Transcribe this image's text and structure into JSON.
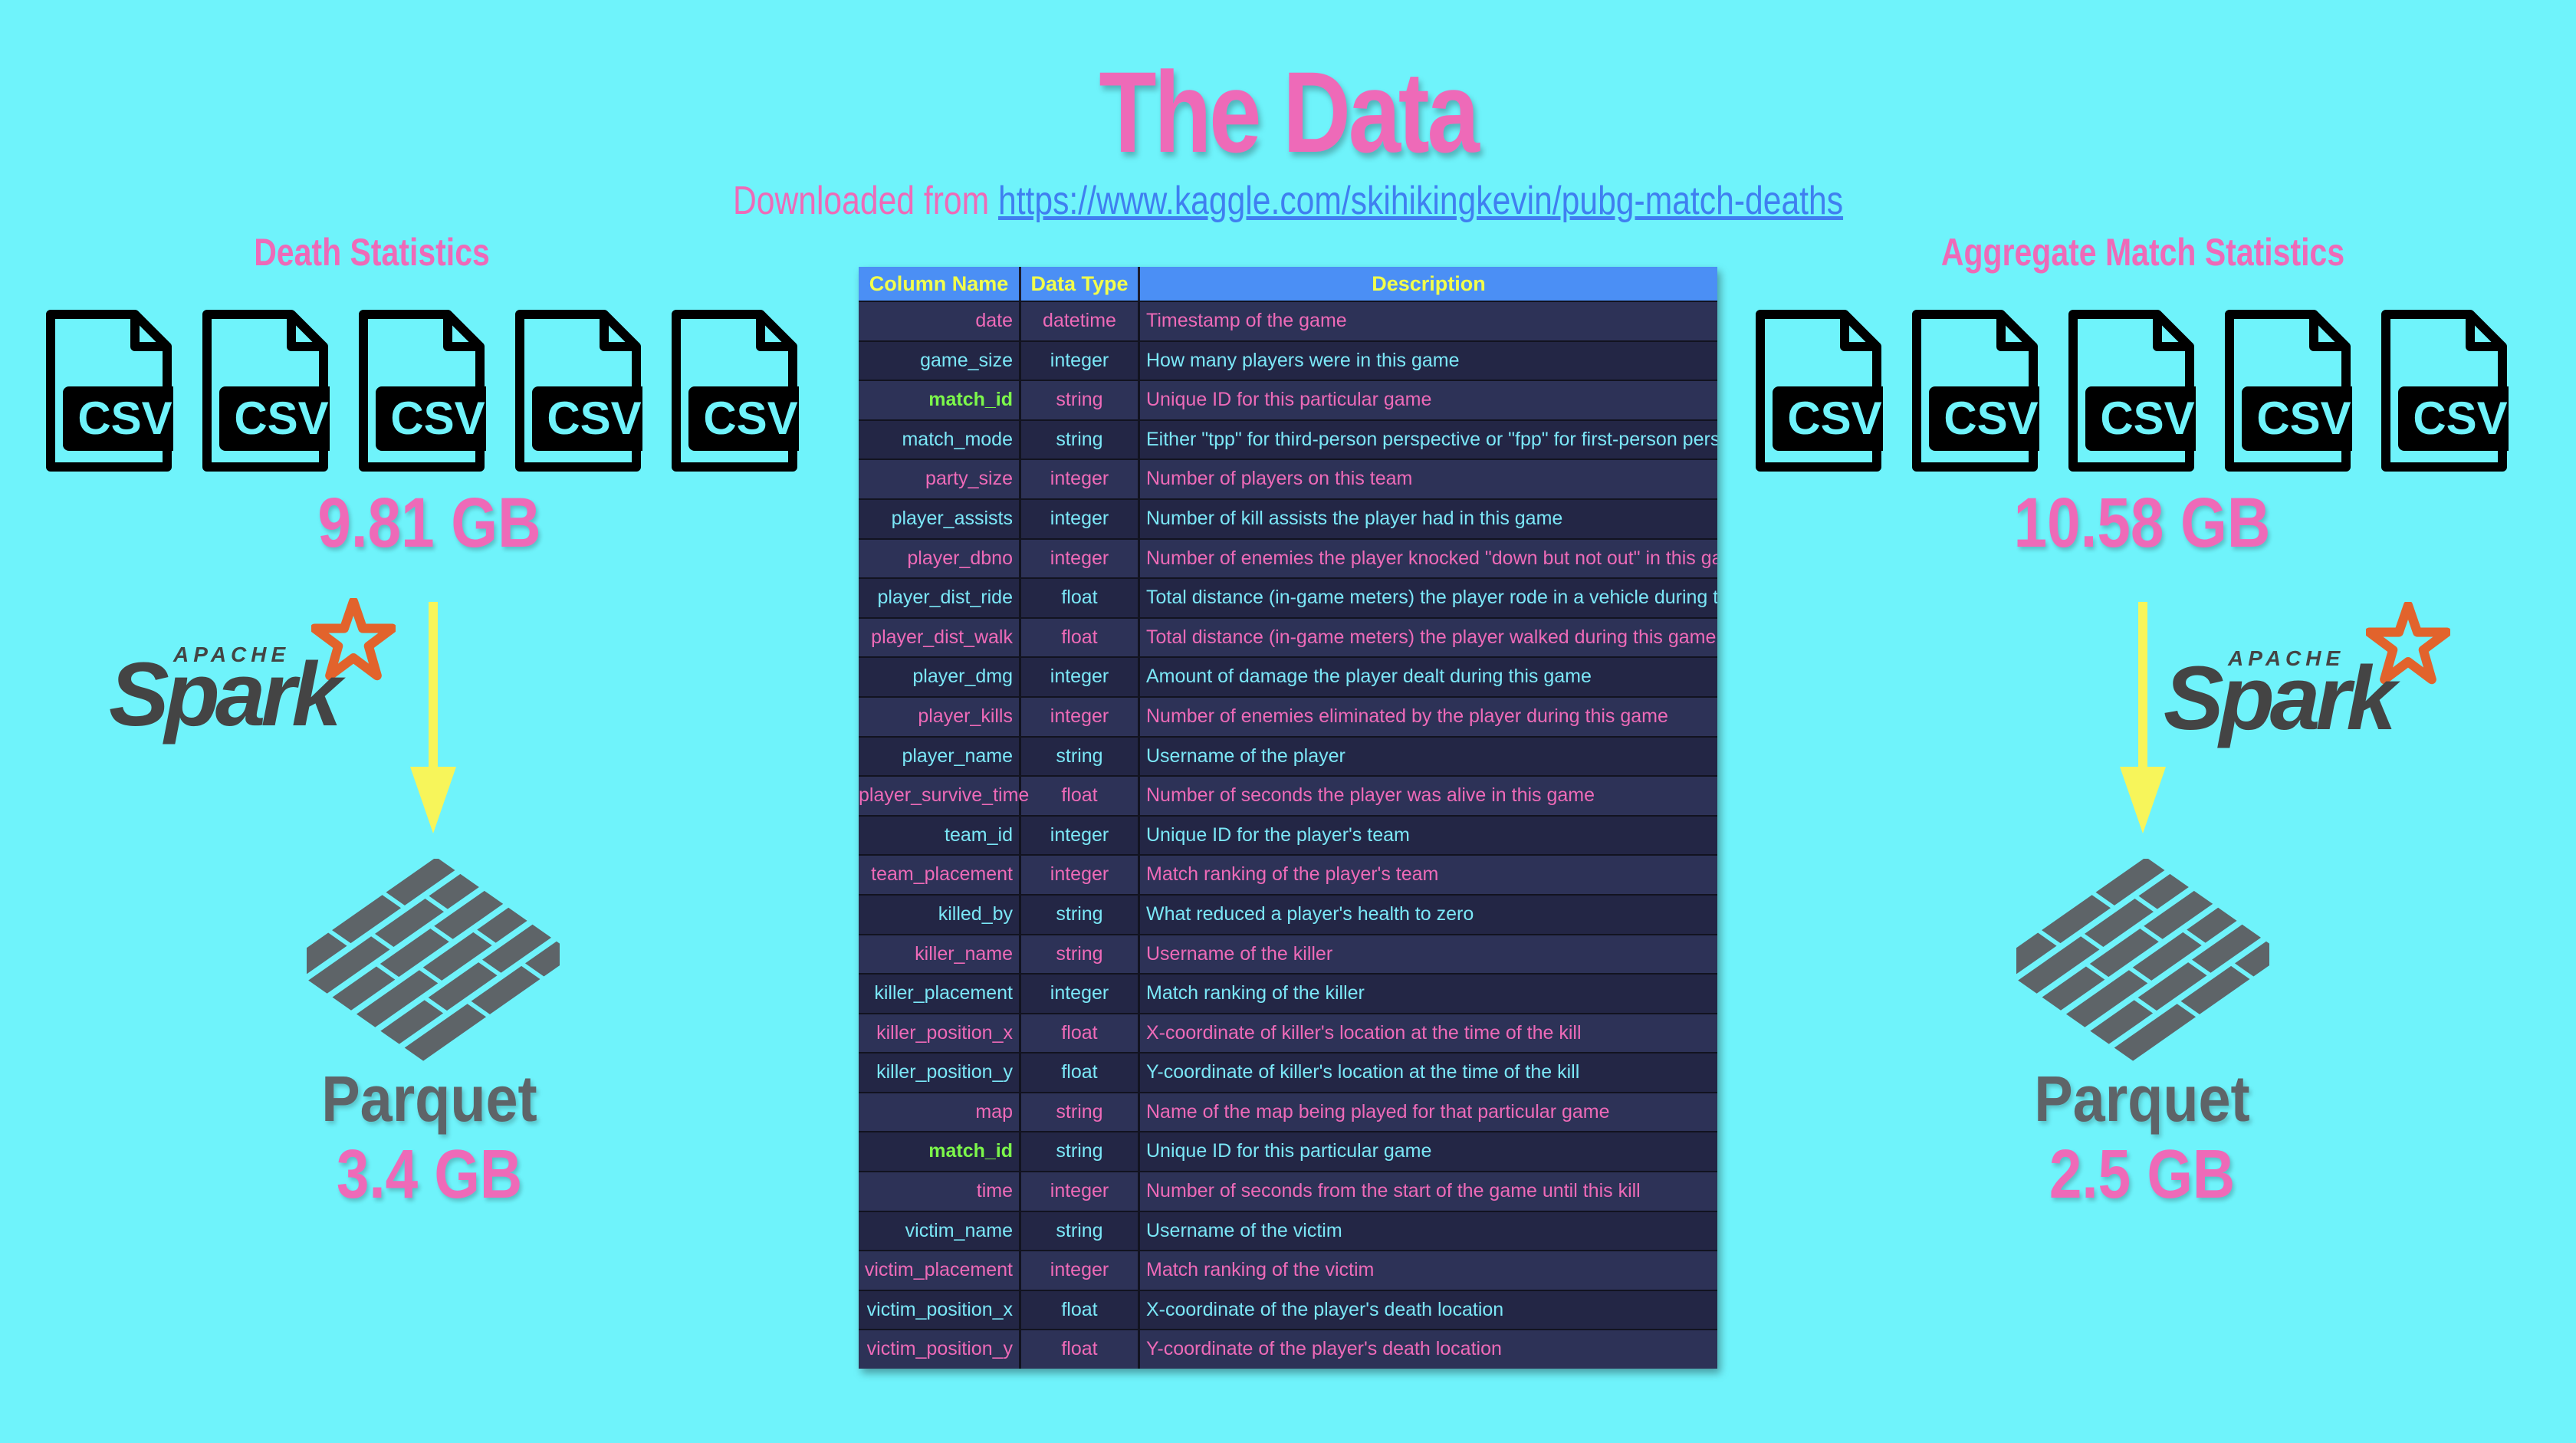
{
  "title": "The Data",
  "subtitle": {
    "prefix": "Downloaded from ",
    "link": "https://www.kaggle.com/skihikingkevin/pubg-match-deaths"
  },
  "left": {
    "heading": "Death Statistics",
    "file_label": "CSV",
    "csv_size": "9.81 GB",
    "spark_apache": "APACHE",
    "spark_name": "Spark",
    "parquet_label": "Parquet",
    "parquet_size": "3.4 GB"
  },
  "right": {
    "heading": "Aggregate Match Statistics",
    "file_label": "CSV",
    "csv_size": "10.58 GB",
    "spark_apache": "APACHE",
    "spark_name": "Spark",
    "parquet_label": "Parquet",
    "parquet_size": "2.5 GB"
  },
  "colors": {
    "background": "#6ff3fb",
    "pink": "#ee6ab8",
    "yellow_arrow": "#f7f55a",
    "table_header": "#4b8ff5",
    "highlight_green": "#7cf74a"
  },
  "table": {
    "headers": [
      "Column Name",
      "Data Type",
      "Description"
    ],
    "rows": [
      {
        "name": "date",
        "type": "datetime",
        "desc": "Timestamp of the game",
        "color": "pink"
      },
      {
        "name": "game_size",
        "type": "integer",
        "desc": "How many players were in this game",
        "color": "blue"
      },
      {
        "name": "match_id",
        "type": "string",
        "desc": "Unique ID for this particular game",
        "color": "pink",
        "highlight": true
      },
      {
        "name": "match_mode",
        "type": "string",
        "desc": "Either \"tpp\" for third-person perspective or \"fpp\" for first-person perspective",
        "color": "blue"
      },
      {
        "name": "party_size",
        "type": "integer",
        "desc": "Number of players on this team",
        "color": "pink"
      },
      {
        "name": "player_assists",
        "type": "integer",
        "desc": "Number of kill assists the player had in this game",
        "color": "blue"
      },
      {
        "name": "player_dbno",
        "type": "integer",
        "desc": "Number of enemies the player knocked \"down but not out\" in this game",
        "color": "pink"
      },
      {
        "name": "player_dist_ride",
        "type": "float",
        "desc": "Total distance (in-game meters) the player rode in a vehicle during this game",
        "color": "blue"
      },
      {
        "name": "player_dist_walk",
        "type": "float",
        "desc": "Total distance (in-game meters) the player walked during this game",
        "color": "pink"
      },
      {
        "name": "player_dmg",
        "type": "integer",
        "desc": "Amount of damage the player dealt during this game",
        "color": "blue"
      },
      {
        "name": "player_kills",
        "type": "integer",
        "desc": "Number of enemies eliminated by the player during this game",
        "color": "pink"
      },
      {
        "name": "player_name",
        "type": "string",
        "desc": "Username of the player",
        "color": "blue"
      },
      {
        "name": "player_survive_time",
        "type": "float",
        "desc": "Number of seconds the player was alive in this game",
        "color": "pink"
      },
      {
        "name": "team_id",
        "type": "integer",
        "desc": "Unique ID for the player's team",
        "color": "blue"
      },
      {
        "name": "team_placement",
        "type": "integer",
        "desc": "Match ranking of the player's team",
        "color": "pink"
      },
      {
        "name": "killed_by",
        "type": "string",
        "desc": "What reduced a player's health to zero",
        "color": "blue"
      },
      {
        "name": "killer_name",
        "type": "string",
        "desc": "Username of the killer",
        "color": "pink"
      },
      {
        "name": "killer_placement",
        "type": "integer",
        "desc": "Match ranking of the killer",
        "color": "blue"
      },
      {
        "name": "killer_position_x",
        "type": "float",
        "desc": "X-coordinate of killer's location at the time of the kill",
        "color": "pink"
      },
      {
        "name": "killer_position_y",
        "type": "float",
        "desc": "Y-coordinate of killer's location at the time of the kill",
        "color": "blue"
      },
      {
        "name": "map",
        "type": "string",
        "desc": "Name of the map being played for that particular game",
        "color": "pink"
      },
      {
        "name": "match_id",
        "type": "string",
        "desc": "Unique ID for this particular game",
        "color": "blue",
        "highlight": true
      },
      {
        "name": "time",
        "type": "integer",
        "desc": "Number of seconds from the start of the game until this kill",
        "color": "pink"
      },
      {
        "name": "victim_name",
        "type": "string",
        "desc": "Username of the victim",
        "color": "blue"
      },
      {
        "name": "victim_placement",
        "type": "integer",
        "desc": "Match ranking of the victim",
        "color": "pink"
      },
      {
        "name": "victim_position_x",
        "type": "float",
        "desc": "X-coordinate of the player's death location",
        "color": "blue"
      },
      {
        "name": "victim_position_y",
        "type": "float",
        "desc": "Y-coordinate of the player's death location",
        "color": "pink"
      }
    ]
  }
}
